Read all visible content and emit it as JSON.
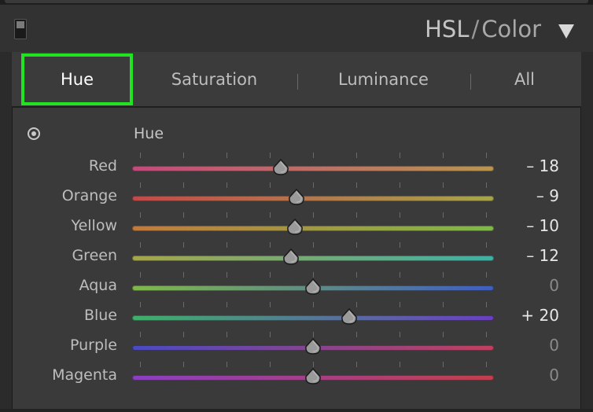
{
  "panel": {
    "title_main": "HSL",
    "title_sep": "/",
    "title_alt": "Color"
  },
  "tabs": [
    {
      "label": "Hue",
      "active": true
    },
    {
      "label": "Saturation",
      "active": false
    },
    {
      "label": "Luminance",
      "active": false
    },
    {
      "label": "All",
      "active": false
    }
  ],
  "section": {
    "label": "Hue",
    "target_icon": "target-adjust-icon"
  },
  "slider_range": [
    -100,
    100
  ],
  "sliders": [
    {
      "label": "Red",
      "value": -18,
      "display": "– 18",
      "gradient": [
        "#c24a7c",
        "#b8954e"
      ]
    },
    {
      "label": "Orange",
      "value": -9,
      "display": "– 9",
      "gradient": [
        "#c24a4a",
        "#a6a54a"
      ]
    },
    {
      "label": "Yellow",
      "value": -10,
      "display": "– 10",
      "gradient": [
        "#c27a3e",
        "#7fb84a"
      ]
    },
    {
      "label": "Green",
      "value": -12,
      "display": "– 12",
      "gradient": [
        "#a6a64a",
        "#3fb0a6"
      ]
    },
    {
      "label": "Aqua",
      "value": 0,
      "display": "0",
      "gradient": [
        "#7fb84a",
        "#3f5ec2"
      ]
    },
    {
      "label": "Blue",
      "value": 20,
      "display": "+ 20",
      "gradient": [
        "#3fb06a",
        "#6a3fc2"
      ]
    },
    {
      "label": "Purple",
      "value": 0,
      "display": "0",
      "gradient": [
        "#4a4ac2",
        "#c23f5e"
      ]
    },
    {
      "label": "Magenta",
      "value": 0,
      "display": "0",
      "gradient": [
        "#8a3fc2",
        "#c23f4a"
      ]
    }
  ]
}
